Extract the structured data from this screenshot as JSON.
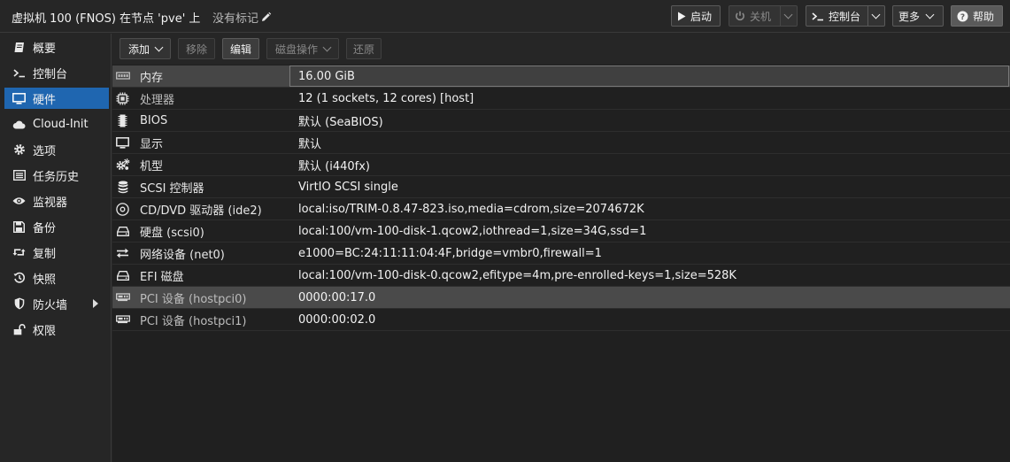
{
  "header": {
    "title": "虚拟机 100 (FNOS) 在节点 'pve' 上",
    "no_tags": "没有标记",
    "buttons": {
      "start": "启动",
      "shutdown": "关机",
      "console": "控制台",
      "more": "更多",
      "help": "帮助"
    }
  },
  "sidebar": {
    "items": [
      {
        "label": "概要",
        "icon": "book-icon"
      },
      {
        "label": "控制台",
        "icon": "terminal-icon"
      },
      {
        "label": "硬件",
        "icon": "desktop-icon",
        "active": true
      },
      {
        "label": "Cloud-Init",
        "icon": "cloud-icon"
      },
      {
        "label": "选项",
        "icon": "gear-icon"
      },
      {
        "label": "任务历史",
        "icon": "list-icon"
      },
      {
        "label": "监视器",
        "icon": "eye-icon"
      },
      {
        "label": "备份",
        "icon": "floppy-icon"
      },
      {
        "label": "复制",
        "icon": "retweet-icon"
      },
      {
        "label": "快照",
        "icon": "history-icon"
      },
      {
        "label": "防火墙",
        "icon": "shield-icon"
      },
      {
        "label": "权限",
        "icon": "unlock-icon"
      }
    ]
  },
  "toolbar": {
    "add": "添加",
    "remove": "移除",
    "edit": "编辑",
    "disk_action": "磁盘操作",
    "revert": "还原"
  },
  "hardware": [
    {
      "key": "内存",
      "value": "16.00 GiB",
      "icon": "memory-icon"
    },
    {
      "key": "处理器",
      "value": "12 (1 sockets, 12 cores) [host]",
      "icon": "cpu-icon"
    },
    {
      "key": "BIOS",
      "value": "默认 (SeaBIOS)",
      "icon": "microchip-icon"
    },
    {
      "key": "显示",
      "value": "默认",
      "icon": "desktop-icon"
    },
    {
      "key": "机型",
      "value": "默认 (i440fx)",
      "icon": "cogs-icon"
    },
    {
      "key": "SCSI 控制器",
      "value": "VirtIO SCSI single",
      "icon": "database-icon"
    },
    {
      "key": "CD/DVD 驱动器 (ide2)",
      "value": "local:iso/TRIM-0.8.47-823.iso,media=cdrom,size=2074672K",
      "icon": "cdrom-icon"
    },
    {
      "key": "硬盘 (scsi0)",
      "value": "local:100/vm-100-disk-1.qcow2,iothread=1,size=34G,ssd=1",
      "icon": "hdd-icon"
    },
    {
      "key": "网络设备 (net0)",
      "value": "e1000=BC:24:11:11:04:4F,bridge=vmbr0,firewall=1",
      "icon": "exchange-icon"
    },
    {
      "key": "EFI 磁盘",
      "value": "local:100/vm-100-disk-0.qcow2,efitype=4m,pre-enrolled-keys=1,size=528K",
      "icon": "hdd-icon"
    },
    {
      "key": "PCI 设备 (hostpci0)",
      "value": "0000:00:17.0",
      "icon": "pci-icon"
    },
    {
      "key": "PCI 设备 (hostpci1)",
      "value": "0000:00:02.0",
      "icon": "pci-icon"
    }
  ]
}
